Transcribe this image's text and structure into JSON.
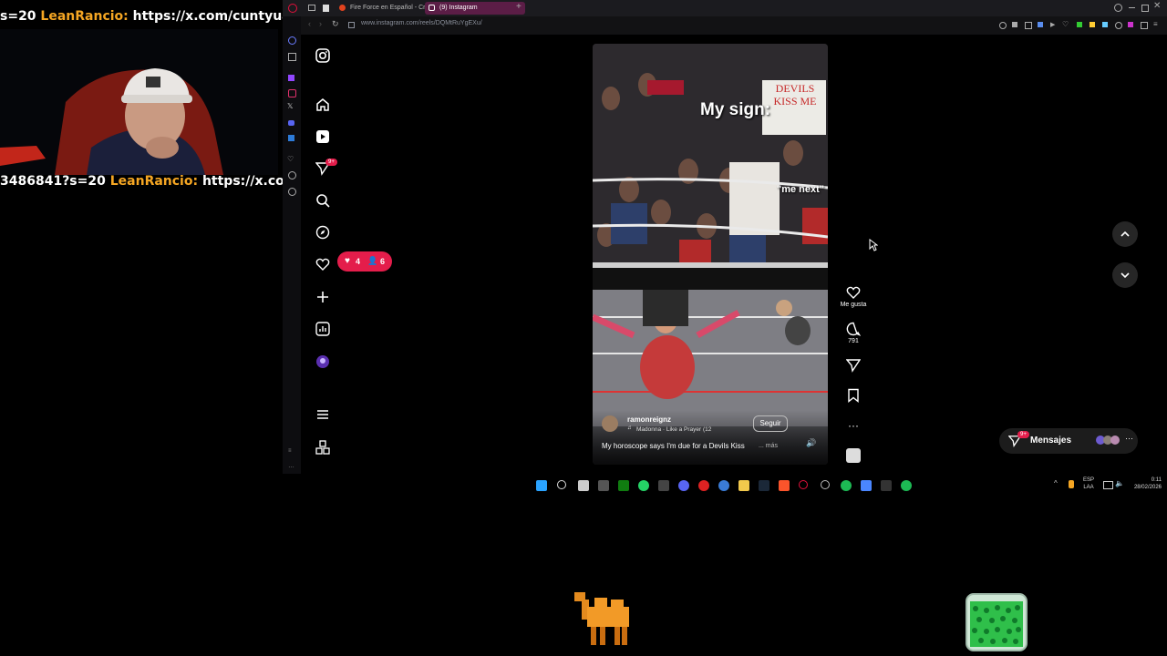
{
  "stream": {
    "chat_top": {
      "prefix": "s=20",
      "user": "LeanRancio:",
      "text": "https://x.com/cuntyuan/status,"
    },
    "chat_bottom": {
      "prefix": "3486841?s=20",
      "user": "LeanRancio:",
      "text": "https://x.com/cunty"
    }
  },
  "browser": {
    "tabs": [
      {
        "label": "Fire Force en Español - Cr"
      },
      {
        "label": "(9) Instagram"
      }
    ],
    "url": "www.instagram.com/reels/DQMtRuYgEXu/"
  },
  "instagram": {
    "notifications_badge": "9+",
    "activity_pill": {
      "likes": "4",
      "followers": "6"
    },
    "reel": {
      "overlay_text_1": "My sign:",
      "overlay_text_2": "\"me next\"",
      "sign_text": "DEVILS KISS ME",
      "author": "ramonreignz",
      "follow_label": "Seguir",
      "song": "Madonna · Like a Prayer (12",
      "caption": "My horoscope says I'm due for a Devils Kiss",
      "more_label": "... más"
    },
    "actions": {
      "like_label": "Me gusta",
      "comment_count": "791"
    },
    "messages": {
      "label": "Mensajes",
      "badge": "9+"
    }
  },
  "taskbar": {
    "lang": "ESP",
    "layout": "LAA",
    "time": "0:11",
    "date": "28/02/2026"
  },
  "colors": {
    "accent_red": "#e41d4b",
    "chat_user": "#f5a623",
    "tab_active": "#5b1d46"
  }
}
